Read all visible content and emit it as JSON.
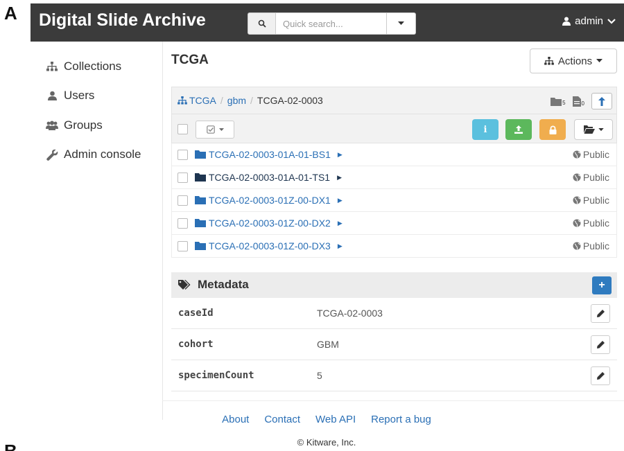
{
  "panel_labels": {
    "a": "A",
    "b": "B"
  },
  "navbar": {
    "brand": "Digital Slide Archive",
    "search": {
      "placeholder": "Quick search..."
    },
    "user": "admin"
  },
  "sidebar": {
    "items": [
      {
        "label": "Collections",
        "icon": "sitemap-icon"
      },
      {
        "label": "Users",
        "icon": "user-icon"
      },
      {
        "label": "Groups",
        "icon": "users-icon"
      },
      {
        "label": "Admin console",
        "icon": "wrench-icon"
      }
    ]
  },
  "main": {
    "title": "TCGA",
    "actions_label": "Actions",
    "breadcrumb": {
      "root": "TCGA",
      "items": [
        "gbm"
      ],
      "current": "TCGA-02-0003"
    },
    "counts": {
      "folders": "5",
      "items": "0"
    },
    "colors": {
      "info": "#5bc0de",
      "success": "#5cb85c",
      "warning": "#f0ad4e",
      "primary": "#2f7bbf",
      "link": "#2a6fb5"
    },
    "folders": [
      {
        "name": "TCGA-02-0003-01A-01-BS1",
        "access": "Public"
      },
      {
        "name": "TCGA-02-0003-01A-01-TS1",
        "access": "Public"
      },
      {
        "name": "TCGA-02-0003-01Z-00-DX1",
        "access": "Public"
      },
      {
        "name": "TCGA-02-0003-01Z-00-DX2",
        "access": "Public"
      },
      {
        "name": "TCGA-02-0003-01Z-00-DX3",
        "access": "Public"
      }
    ]
  },
  "metadata": {
    "title": "Metadata",
    "rows": [
      {
        "key": "caseId",
        "value": "TCGA-02-0003"
      },
      {
        "key": "cohort",
        "value": "GBM"
      },
      {
        "key": "specimenCount",
        "value": "5"
      }
    ]
  },
  "footer": {
    "links": [
      "About",
      "Contact",
      "Web API",
      "Report a bug"
    ],
    "copyright": "© Kitware, Inc."
  }
}
